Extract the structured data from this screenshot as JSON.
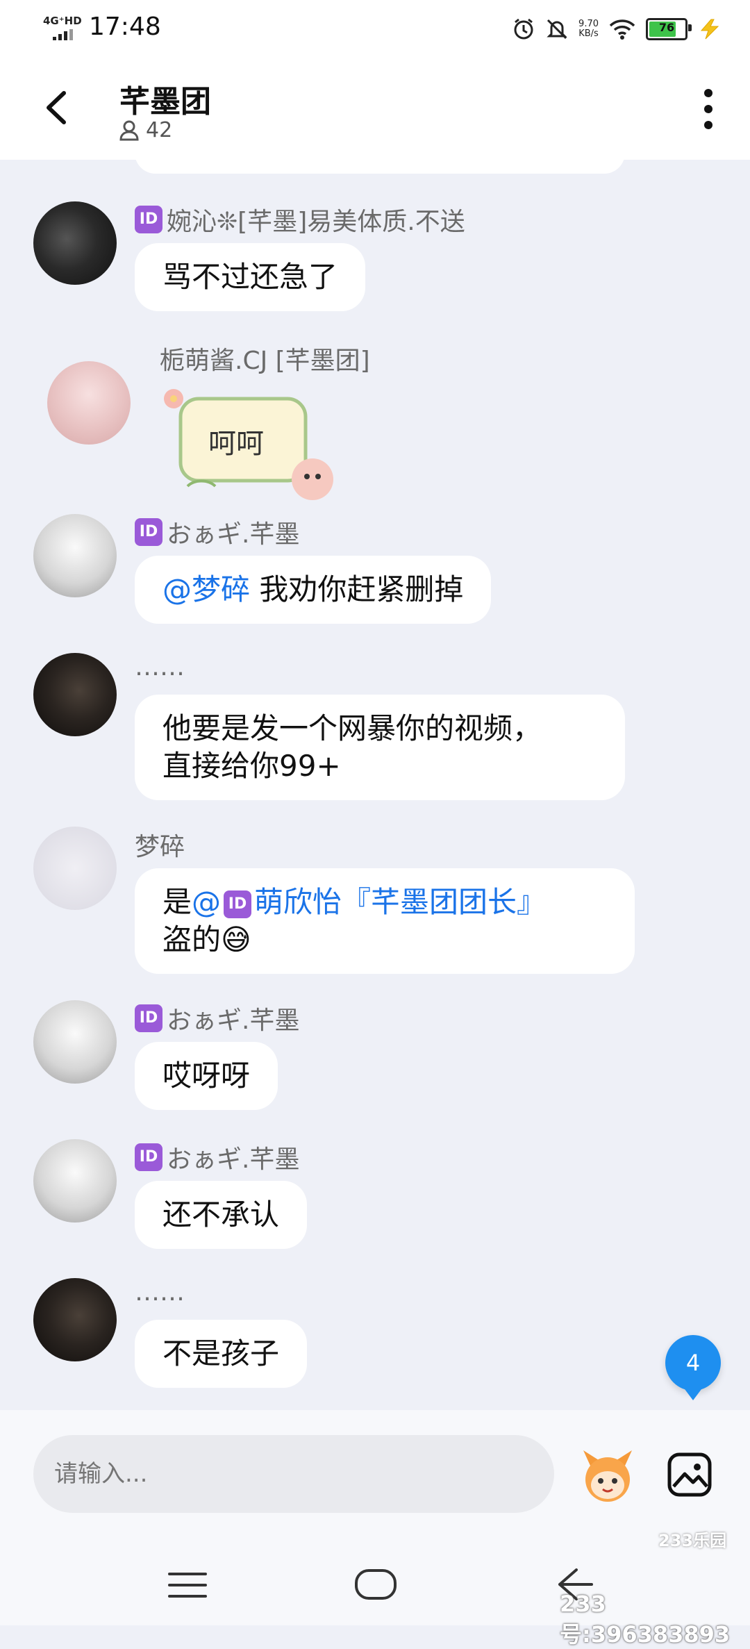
{
  "status_bar": {
    "network": "4G⁺HD",
    "time": "17:48",
    "speed_value": "9.70",
    "speed_unit": "KB/s",
    "battery": "76"
  },
  "header": {
    "title": "芊墨团",
    "member_count": "42"
  },
  "messages": [
    {
      "nick": "婉沁❊[芊墨]易美体质.不送",
      "has_id_badge": true,
      "text": "骂不过还急了"
    },
    {
      "nick": "栀萌酱.CJ [芊墨团]",
      "has_id_badge": false,
      "sticker_text": "呵呵"
    },
    {
      "nick": "おぁギ.芊墨",
      "has_id_badge": true,
      "mention": "@梦碎",
      "text": " 我劝你赶紧删掉"
    },
    {
      "nick": "……",
      "has_id_badge": false,
      "text_line1": "他要是发一个网暴你的视频，",
      "text_line2": "直接给你99+"
    },
    {
      "nick": "梦碎",
      "has_id_badge": false,
      "prefix": "是",
      "mention": "@",
      "mention_name": "萌欣怡『芊墨团团长』",
      "text_line2": "盗的😅"
    },
    {
      "nick": "おぁギ.芊墨",
      "has_id_badge": true,
      "text": "哎呀呀"
    },
    {
      "nick": "おぁギ.芊墨",
      "has_id_badge": true,
      "text": "还不承认"
    },
    {
      "nick": "……",
      "has_id_badge": false,
      "text": "不是孩子"
    }
  ],
  "id_badge_text": "ID",
  "unread_count": "4",
  "input": {
    "placeholder": "请输入..."
  },
  "watermark": {
    "logo": "233乐园",
    "id": "233号:396383893"
  }
}
